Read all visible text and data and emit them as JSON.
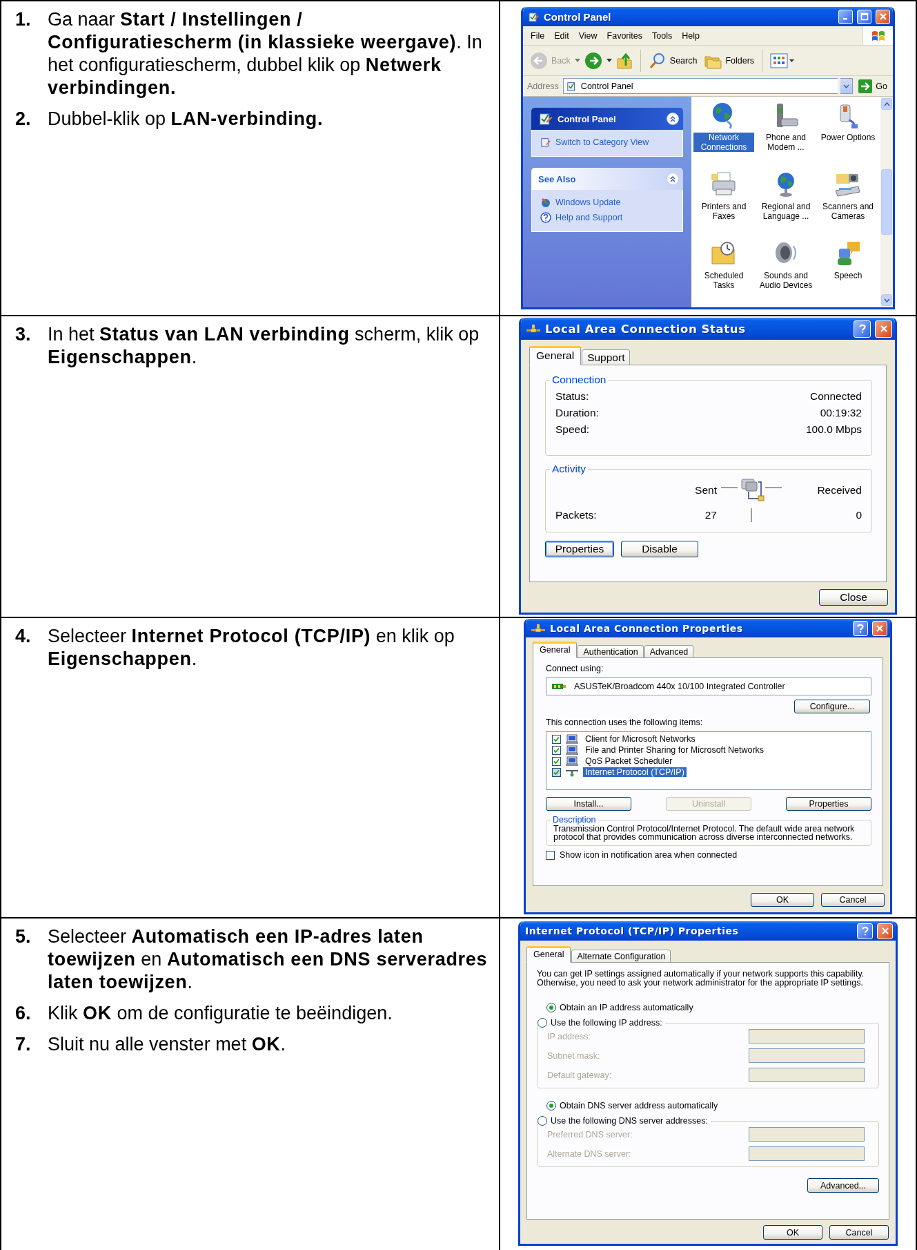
{
  "rows": [
    {
      "steps": [
        {
          "number": "1.",
          "text": "Ga naar **Start / Instellingen / Configuratiescherm (in klassieke weergave)**. In het configuratiescherm, dubbel klik op **Netwerk verbindingen.**"
        },
        {
          "number": "2.",
          "text": "Dubbel-klik op **LAN-verbinding.**"
        }
      ],
      "screen": {
        "kind": "explorer",
        "title": "Control Panel",
        "menu": [
          "File",
          "Edit",
          "View",
          "Favorites",
          "Tools",
          "Help"
        ],
        "toolbar": {
          "back": {
            "label": "Back",
            "disabled": true
          },
          "search": "Search",
          "folders": "Folders"
        },
        "address": {
          "label": "Address",
          "value": "Control Panel",
          "go": "Go"
        },
        "panels": [
          {
            "title": "Control Panel",
            "kind": "header",
            "links": [
              "Switch to Category View"
            ]
          },
          {
            "title": "See Also",
            "kind": "plain",
            "links": [
              "Windows Update",
              "Help and Support"
            ]
          }
        ],
        "items": [
          {
            "label": "Network Connections",
            "selected": true
          },
          {
            "label": "Phone and Modem ...",
            "selected": false
          },
          {
            "label": "Power Options",
            "selected": false
          },
          {
            "label": "Printers and Faxes",
            "selected": false
          },
          {
            "label": "Regional and Language ...",
            "selected": false
          },
          {
            "label": "Scanners and Cameras",
            "selected": false
          },
          {
            "label": "Scheduled Tasks",
            "selected": false
          },
          {
            "label": "Sounds and Audio Devices",
            "selected": false
          },
          {
            "label": "Speech",
            "selected": false
          }
        ]
      }
    },
    {
      "steps": [
        {
          "number": "3.",
          "text": "In het **Status van LAN verbinding** scherm, klik op **Eigenschappen**."
        }
      ],
      "screen": {
        "kind": "status",
        "title": "Local Area Connection Status",
        "tabs": [
          {
            "label": "General",
            "selected": true
          },
          {
            "label": "Support",
            "selected": false
          }
        ],
        "connection": {
          "title": "Connection",
          "fields": [
            {
              "label": "Status:",
              "value": "Connected"
            },
            {
              "label": "Duration:",
              "value": "00:19:32"
            },
            {
              "label": "Speed:",
              "value": "100.0 Mbps"
            }
          ]
        },
        "activity": {
          "title": "Activity",
          "sent": "Sent",
          "received": "Received",
          "packets_label": "Packets:",
          "sent_packets": "27",
          "received_packets": "0"
        },
        "buttons": [
          {
            "label": "Properties",
            "default": true
          },
          {
            "label": "Disable",
            "default": false
          }
        ],
        "close": "Close"
      }
    },
    {
      "steps": [
        {
          "number": "4.",
          "text": "Selecteer **Internet Protocol (TCP/IP)** en klik op **Eigenschappen**."
        }
      ],
      "screen": {
        "kind": "properties",
        "title": "Local Area Connection Properties",
        "tabs": [
          {
            "label": "General",
            "selected": true
          },
          {
            "label": "Authentication",
            "selected": false
          },
          {
            "label": "Advanced",
            "selected": false
          }
        ],
        "connect_label": "Connect using:",
        "adapter": "ASUSTeK/Broadcom 440x 10/100 Integrated Controller",
        "configure": "Configure...",
        "items_label": "This connection uses the following items:",
        "items": [
          {
            "label": "Client for Microsoft Networks",
            "checked": true,
            "selected": false
          },
          {
            "label": "File and Printer Sharing for Microsoft Networks",
            "checked": true,
            "selected": false
          },
          {
            "label": "QoS Packet Scheduler",
            "checked": true,
            "selected": false
          },
          {
            "label": "Internet Protocol (TCP/IP)",
            "checked": true,
            "selected": true
          }
        ],
        "buttons": [
          {
            "label": "Install...",
            "disabled": false
          },
          {
            "label": "Uninstall",
            "disabled": true
          },
          {
            "label": "Properties",
            "disabled": false
          }
        ],
        "description": {
          "title": "Description",
          "text": "Transmission Control Protocol/Internet Protocol. The default wide area network protocol that provides communication across diverse interconnected networks."
        },
        "show_icon": {
          "label": "Show icon in notification area when connected",
          "checked": false
        },
        "ok": "OK",
        "cancel": "Cancel"
      }
    },
    {
      "steps": [
        {
          "number": "5.",
          "text": "Selecteer **Automatisch een IP-adres laten toewijzen** en **Automatisch een DNS serveradres laten toewijzen**."
        },
        {
          "number": "6.",
          "text": "Klik **OK** om de configuratie te beëindigen."
        },
        {
          "number": "7.",
          "text": "Sluit nu alle venster met **OK**."
        }
      ],
      "screen": {
        "kind": "tcpip",
        "title": "Internet Protocol (TCP/IP) Properties",
        "tabs": [
          {
            "label": "General",
            "selected": true
          },
          {
            "label": "Alternate Configuration",
            "selected": false
          }
        ],
        "intro": "You can get IP settings assigned automatically if your network supports this capability. Otherwise, you need to ask your network administrator for the appropriate IP settings.",
        "ip_options": [
          {
            "label": "Obtain an IP address automatically",
            "selected": true
          },
          {
            "label": "Use the following IP address:",
            "selected": false
          }
        ],
        "ip_fields": [
          {
            "label": "IP address:",
            "disabled": true
          },
          {
            "label": "Subnet mask:",
            "disabled": true
          },
          {
            "label": "Default gateway:",
            "disabled": true
          }
        ],
        "dns_options": [
          {
            "label": "Obtain DNS server address automatically",
            "selected": true
          },
          {
            "label": "Use the following DNS server addresses:",
            "selected": false
          }
        ],
        "dns_fields": [
          {
            "label": "Preferred DNS server:",
            "disabled": true
          },
          {
            "label": "Alternate DNS server:",
            "disabled": true
          }
        ],
        "advanced": "Advanced...",
        "ok": "OK",
        "cancel": "Cancel"
      }
    }
  ]
}
